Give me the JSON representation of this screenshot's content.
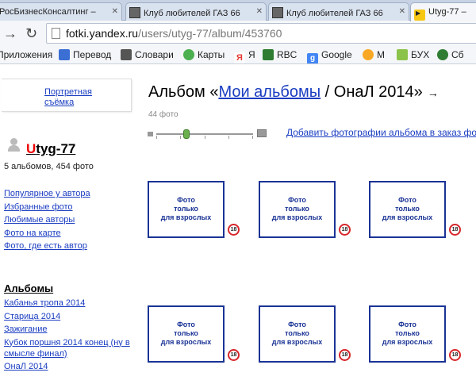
{
  "browser": {
    "tabs": [
      {
        "title": "РосБизнесКонсалтинг –",
        "active": false,
        "icon": "rbc-icon"
      },
      {
        "title": "Клуб любителей ГАЗ 66",
        "active": false,
        "icon": "forum-icon"
      },
      {
        "title": "Клуб любителей ГАЗ 66",
        "active": false,
        "icon": "forum-icon"
      },
      {
        "title": "Utyg-77 –",
        "active": true,
        "icon": "yandex-fotki-icon"
      }
    ],
    "url_host": "fotki.yandex.ru",
    "url_path": "/users/utyg-77/album/453760",
    "bookmarks": [
      {
        "label": "Приложения",
        "icon": "apps-icon",
        "color": "#d04437"
      },
      {
        "label": "Перевод",
        "icon": "translate-icon",
        "color": "#3b6fd4"
      },
      {
        "label": "Словари",
        "icon": "dictionary-icon",
        "color": "#555555"
      },
      {
        "label": "Карты",
        "icon": "maps-icon",
        "color": "#4caf50"
      },
      {
        "label": "Я",
        "icon": "yandex-icon",
        "color": "#e53935"
      },
      {
        "label": "RBC",
        "icon": "rbc-icon",
        "color": "#2e7d32"
      },
      {
        "label": "Google",
        "icon": "google-icon",
        "color": "#4285f4"
      },
      {
        "label": "M",
        "icon": "mail-icon",
        "color": "#f9a825"
      },
      {
        "label": "БУХ",
        "icon": "buh-icon",
        "color": "#8bc34a"
      },
      {
        "label": "Сб",
        "icon": "sber-icon",
        "color": "#2e7d32"
      }
    ]
  },
  "sidebar": {
    "promo_link": "Портретная съёмка",
    "user": {
      "name_first": "U",
      "name_rest": "tyg-77",
      "stats": "5 альбомов, 454 фото"
    },
    "links": [
      "Популярное у автора",
      "Избранные фото",
      "Любимые авторы",
      "Фото на карте",
      "Фото, где есть автор"
    ],
    "albums_title": "Альбомы",
    "albums": [
      "Кабанья тропа 2014",
      "Старица 2014",
      "Зажигание",
      "Кубок поршня 2014 конец (ну в смысле финал)",
      "ОнаЛ 2014"
    ]
  },
  "main": {
    "title_prefix": "Альбом «",
    "title_link": "Мои альбомы",
    "title_suffix": " / ОнаЛ 2014»",
    "title_arrow": "→",
    "photo_count": "44 фото",
    "add_photos_link": "Добавить фотографии альбома в заказ фото",
    "photos": [
      {
        "text": "Фото\nтолько\nдля взрослых",
        "badge": "18"
      },
      {
        "text": "Фото\nтолько\nдля взрослых",
        "badge": "18"
      },
      {
        "text": "Фото\nтолько\nдля взрослых",
        "badge": "18"
      },
      {
        "text": "Фото\nтолько\nдля взрослых",
        "badge": "18"
      },
      {
        "text": "Фото\nтолько\nдля взрослых",
        "badge": "18"
      },
      {
        "text": "Фото\nтолько\nдля взрослых",
        "badge": "18"
      }
    ],
    "zoom_level": 0.3
  },
  "colors": {
    "link": "#1a3dc1",
    "thumb_border": "#1a3395",
    "badge_ring": "#d7262b",
    "user_first_letter": "#ee0000"
  }
}
